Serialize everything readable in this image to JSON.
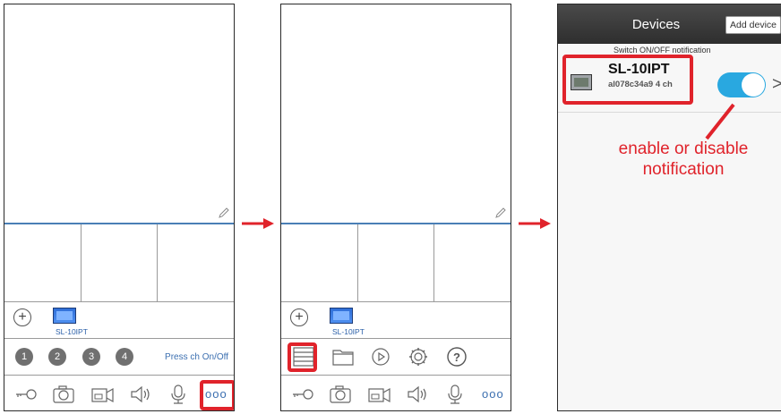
{
  "panel1": {
    "device_label": "SL-10IPT",
    "channels": [
      "1",
      "2",
      "3",
      "4"
    ],
    "press_label": "Press ch On/Off",
    "more_icon": "ooo"
  },
  "panel2": {
    "device_label": "SL-10IPT",
    "more_icon": "ooo"
  },
  "panel3": {
    "title": "Devices",
    "add_device": "Add device",
    "switch_note": "Switch ON/OFF notification",
    "device_name": "SL-10IPT",
    "device_id": "al078c34a9 4 ch",
    "notification_enabled": true,
    "chevron": ">",
    "annotation_line1": "enable or disable",
    "annotation_line2": "notification"
  },
  "colors": {
    "highlight": "#e0232b",
    "toggle": "#29a8e0",
    "accent": "#3b6fb0"
  }
}
